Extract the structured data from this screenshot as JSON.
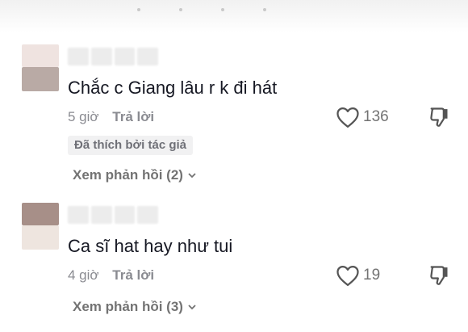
{
  "comments": [
    {
      "text": "Chắc c Giang lâu r k đi hát",
      "time": "5 giờ",
      "reply_label": "Trả lời",
      "likes": "136",
      "badge": "Đã thích bởi tác giả",
      "view_replies": "Xem phản hồi (2)"
    },
    {
      "text": "Ca sĩ hat hay như tui",
      "time": "4 giờ",
      "reply_label": "Trả lời",
      "likes": "19",
      "view_replies": "Xem phản hồi (3)"
    }
  ],
  "icons": {
    "like": "heart-outline-icon",
    "dislike": "thumbs-down-icon",
    "expand": "chevron-down-icon"
  },
  "colors": {
    "text": "#161823",
    "muted": "#8a8b91",
    "badge_bg": "#f1f1f2"
  }
}
